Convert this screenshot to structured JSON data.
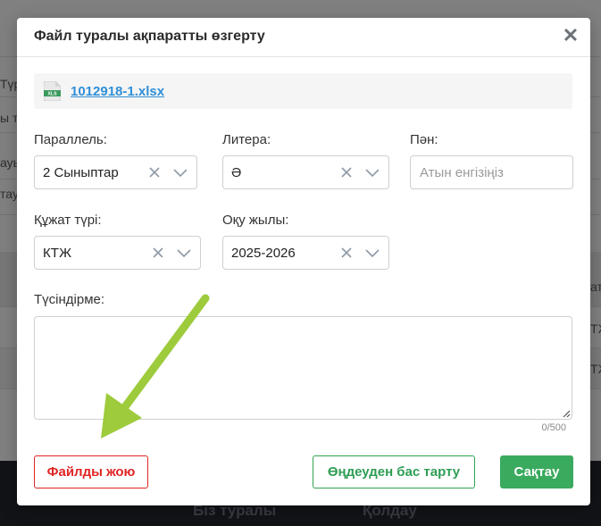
{
  "background": {
    "fragments": [
      "Түрі",
      "ы ту",
      "ауы",
      "тау",
      "ат",
      "ТЖ",
      "ТЖ"
    ],
    "footer_links": [
      "Біз туралы",
      "Қолдау"
    ]
  },
  "modal": {
    "title": "Файл туралы ақпаратты өзгерту",
    "close_symbol": "✕",
    "file": {
      "icon": "xls-file-icon",
      "icon_text": "XLS",
      "name": "1012918-1.xlsx"
    },
    "fields": {
      "parallel": {
        "label": "Параллель:",
        "value": "2 Сыныптар"
      },
      "litera": {
        "label": "Литера:",
        "value": "Ә"
      },
      "subject": {
        "label": "Пән:",
        "placeholder": "Атын енгізіңіз",
        "value": ""
      },
      "doc_type": {
        "label": "Құжат түрі:",
        "value": "КТЖ"
      },
      "year": {
        "label": "Оқу жылы:",
        "value": "2025-2026"
      },
      "comment": {
        "label": "Түсіндірме:",
        "value": "",
        "counter": "0/500"
      }
    },
    "buttons": {
      "delete": "Файлды жою",
      "cancel": "Өңдеуден бас тарту",
      "save": "Сақтау"
    }
  },
  "colors": {
    "danger": "#e02424",
    "success": "#3aaa5e",
    "link": "#2f8fd8",
    "annotation_arrow": "#9dcb3c"
  }
}
